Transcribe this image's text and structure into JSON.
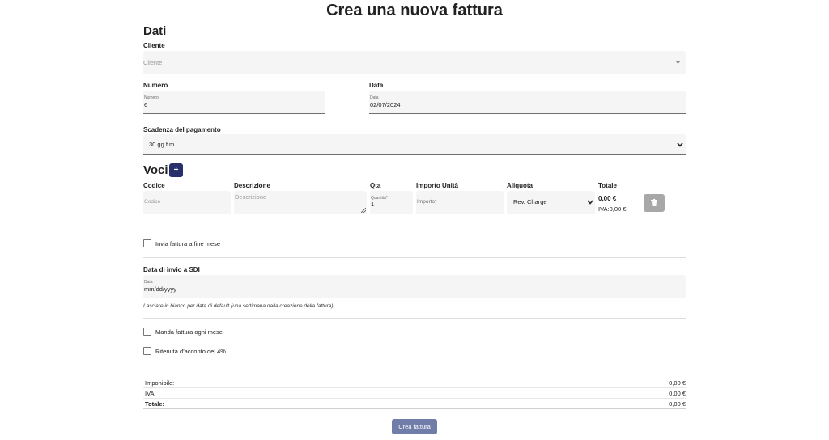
{
  "page": {
    "title": "Crea una nuova fattura"
  },
  "dati": {
    "heading": "Dati",
    "cliente": {
      "label": "Cliente",
      "placeholder": "Cliente"
    },
    "numero": {
      "label": "Numero",
      "float_label": "Numero",
      "value": "6"
    },
    "data": {
      "label": "Data",
      "float_label": "Data",
      "value": "02/07/2024"
    },
    "scadenza": {
      "label": "Scadenza del pagamento",
      "value": "30 gg f.m."
    }
  },
  "voci": {
    "heading": "Voci",
    "add_label": "+",
    "columns": {
      "codice": "Codice",
      "descrizione": "Descrizione",
      "qta": "Qta",
      "importo": "Importo Unità",
      "aliquota": "Aliquota",
      "totale": "Totale"
    },
    "row": {
      "codice_placeholder": "Codice",
      "descrizione_placeholder": "Descrizione",
      "qta_float_label": "Quantità*",
      "qta_value": "1",
      "importo_placeholder": "Importo*",
      "aliquota_value": "Rev. Charge",
      "totale_value": "0,00 €",
      "iva_value": "IVA:0,00 €"
    }
  },
  "options": {
    "invia_fine_mese": "Invia fattura a fine mese",
    "sdi_label": "Data di invio a SDI",
    "sdi_float_label": "Data",
    "sdi_placeholder": "mm/dd/yyyy",
    "sdi_hint": "Lasciare in bianco per data di default (una settimana dalla creazione della fattura)",
    "manda_ogni_mese": "Manda fattura ogni mese",
    "ritenuta": "Ritenuta d'acconto del 4%"
  },
  "totals": {
    "imponibile_label": "Imponibile:",
    "imponibile_value": "0,00 €",
    "iva_label": "IVA:",
    "iva_value": "0,00 €",
    "totale_label": "Totale:",
    "totale_value": "0,00 €"
  },
  "submit_label": "Crea fattura",
  "colors": {
    "primary": "#27306b",
    "submit": "#6f7da8",
    "field_bg": "#f5f5f5",
    "disabled": "#a8a8a8"
  }
}
